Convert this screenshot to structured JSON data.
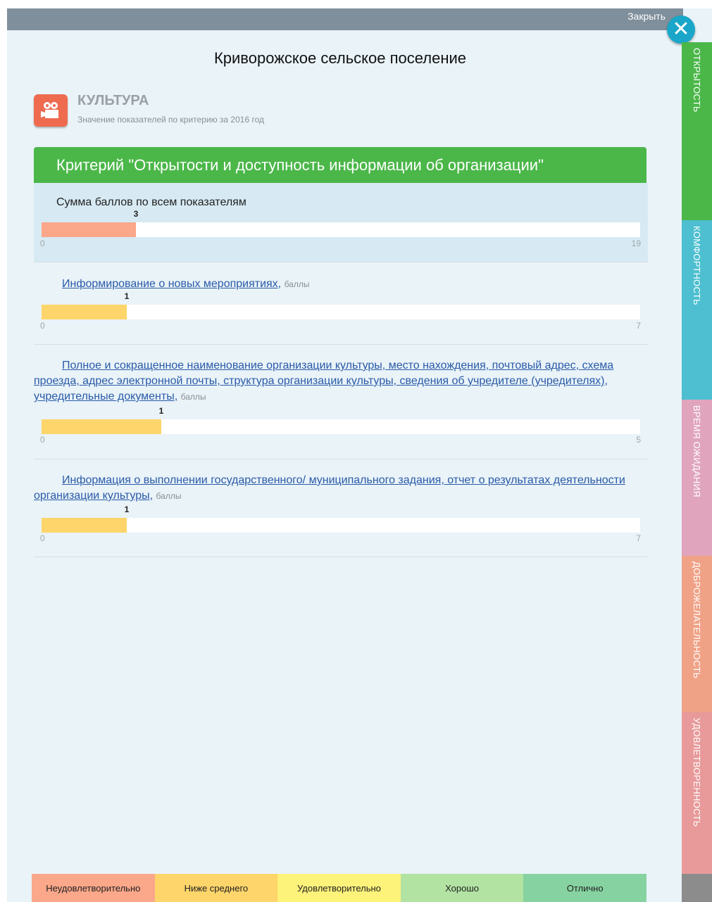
{
  "header": {
    "close_label": "Закрыть",
    "close_icon": "close-icon"
  },
  "page_title": "Криворожское сельское поселение",
  "section": {
    "icon": "movie-camera-icon",
    "title": "КУЛЬТУРА",
    "subtitle": "Значение показателей по критерию за 2016 год"
  },
  "criterion": {
    "title": "Критерий \"Открытости и доступность информации об организации\""
  },
  "total": {
    "label": "Сумма баллов по всем показателям",
    "value": "3",
    "min": "0",
    "max": "19",
    "fraction": 0.1579,
    "color": "#fba78a"
  },
  "indicators": [
    {
      "label": "Информирование о новых мероприятиях,",
      "unit": "баллы",
      "value": "1",
      "min": "0",
      "max": "7",
      "fraction": 0.1429,
      "color": "#fdd56a"
    },
    {
      "label": "Полное и сокращенное наименование организации культуры, место нахождения, почтовый адрес, схема проезда, адрес электронной почты, структура организации культуры, сведения об учредителе (учредителях), учредительные документы,",
      "unit": "баллы",
      "value": "1",
      "min": "0",
      "max": "5",
      "fraction": 0.2,
      "color": "#fdd56a"
    },
    {
      "label": "Информация о выполнении государственного/ муниципального задания, отчет о результатах деятельности организации культуры,",
      "unit": "баллы",
      "value": "1",
      "min": "0",
      "max": "7",
      "fraction": 0.1429,
      "color": "#fdd56a"
    }
  ],
  "legend": [
    {
      "label": "Неудовлетворительно",
      "color": "#fba78a"
    },
    {
      "label": "Ниже среднего",
      "color": "#fdd56a"
    },
    {
      "label": "Удовлетворительно",
      "color": "#fdf27a"
    },
    {
      "label": "Хорошо",
      "color": "#b2e3a3"
    },
    {
      "label": "Отлично",
      "color": "#86d3a1"
    }
  ],
  "tabs": [
    {
      "label": "ОТКРЫТОСТЬ",
      "color": "#4bb749"
    },
    {
      "label": "КОМФОРТНОСТЬ",
      "color": "#4dbfd0"
    },
    {
      "label": "ВРЕМЯ ОЖИДАНИЯ",
      "color": "#e0a5bd"
    },
    {
      "label": "ДОБРОЖЕЛАТЕЛЬНОСТЬ",
      "color": "#f0a287"
    },
    {
      "label": "УДОВЛЕТВОРЕННОСТЬ",
      "color": "#e89a9a"
    }
  ]
}
